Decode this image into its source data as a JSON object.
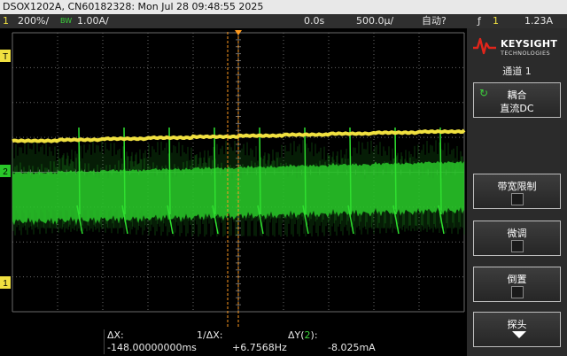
{
  "title_bar": "DSOX1202A, CN60182328: Mon Jul 28 09:48:55 2025",
  "status": {
    "ch1_num": "1",
    "ch1_scale": "200%/",
    "ch2_label": "BW",
    "ch2_scale": "1.00A/",
    "time_delay": "0.0s",
    "time_scale": "500.0µ/",
    "trig_mode": "自动?",
    "trig_icon": "ƒ",
    "trig_src": "1",
    "trig_level": "1.23A"
  },
  "markers": {
    "trigger_level": "T",
    "ch2_ground": "2",
    "ch1_ground": "1"
  },
  "panel": {
    "logo_name": "KEYSIGHT",
    "logo_sub": "TECHNOLOGIES",
    "title": "通道 1",
    "coupling_label": "耦合",
    "coupling_value": "直流DC",
    "bw_limit_label": "带宽限制",
    "fine_label": "微调",
    "invert_label": "倒置",
    "probe_label": "探头"
  },
  "readout": {
    "dx_label": "ΔX:",
    "dx_value": "-148.00000000ms",
    "inv_dx_label": "1/ΔX:",
    "inv_dx_value": "+6.7568Hz",
    "dy_label_a": "ΔY(",
    "dy_label_ch": "2",
    "dy_label_b": "):",
    "dy_value": "-8.025mA"
  },
  "colors": {
    "ch1": "#f0e040",
    "ch2": "#3bd23b",
    "cursor": "#ff9a1f",
    "grid": "#6a6a6a"
  },
  "icons": {
    "logo": "keysight-wave-icon",
    "coupling": "refresh-icon",
    "probe": "chevron-down-icon"
  }
}
